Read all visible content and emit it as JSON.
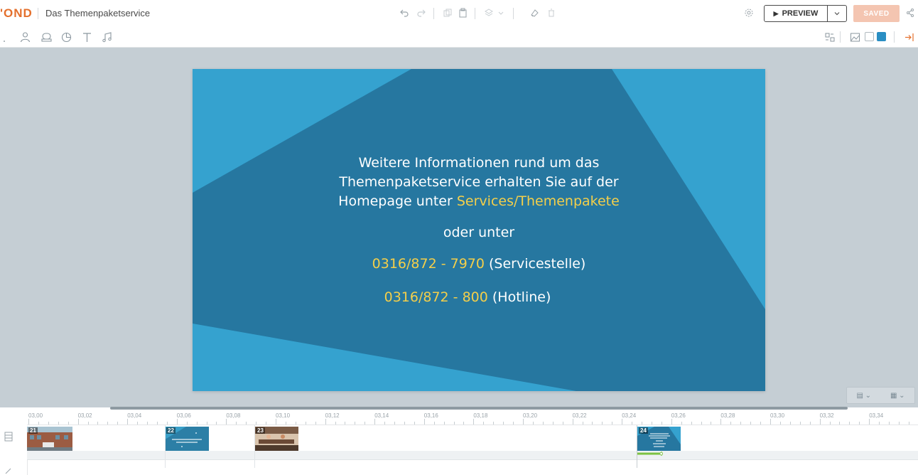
{
  "app": {
    "logo": "'OND",
    "document_title": "Das Themenpaketservice",
    "preview_label": "PREVIEW",
    "saved_label": "SAVED"
  },
  "toolbar_icons": [
    "undo-icon",
    "redo-icon",
    "copy-icon",
    "paste-icon",
    "layers-icon",
    "clear-icon",
    "delete-icon",
    "settings-icon",
    "share-icon"
  ],
  "insert_tools": [
    "character-icon",
    "prop-icon",
    "chart-icon",
    "text-icon",
    "audio-icon"
  ],
  "right_tools": [
    "layout-icon",
    "background-image-icon",
    "color-swatch-white",
    "color-swatch-blue",
    "exit-icon"
  ],
  "colors": {
    "accent": "#e4702d",
    "slide_dark": "#2677a0",
    "slide_light": "#35a2cf",
    "highlight": "#f4cf4a",
    "saved_bg": "#f4c5b1"
  },
  "slide": {
    "line1": "Weitere Informationen rund um das",
    "line2": "Themenpaketservice erhalten Sie auf der",
    "line3_white": "Homepage unter ",
    "line3_yellow": "Services/Themenpakete",
    "line4": "oder unter",
    "phone1_number": "0316/872 - 7970",
    "phone1_label": " (Servicestelle)",
    "phone2_number": "0316/872 - 800",
    "phone2_label": " (Hotline)"
  },
  "timeline": {
    "ticks": [
      "03,00",
      "03,02",
      "03,04",
      "03,06",
      "03,08",
      "03,10",
      "03,12",
      "03,14",
      "03,16",
      "03,18",
      "03,20",
      "03,22",
      "03,24",
      "03,26",
      "03,28",
      "03,30",
      "03,32",
      "03,34"
    ],
    "scenes": [
      {
        "number": "21"
      },
      {
        "number": "22"
      },
      {
        "number": "23"
      },
      {
        "number": "24"
      }
    ]
  }
}
